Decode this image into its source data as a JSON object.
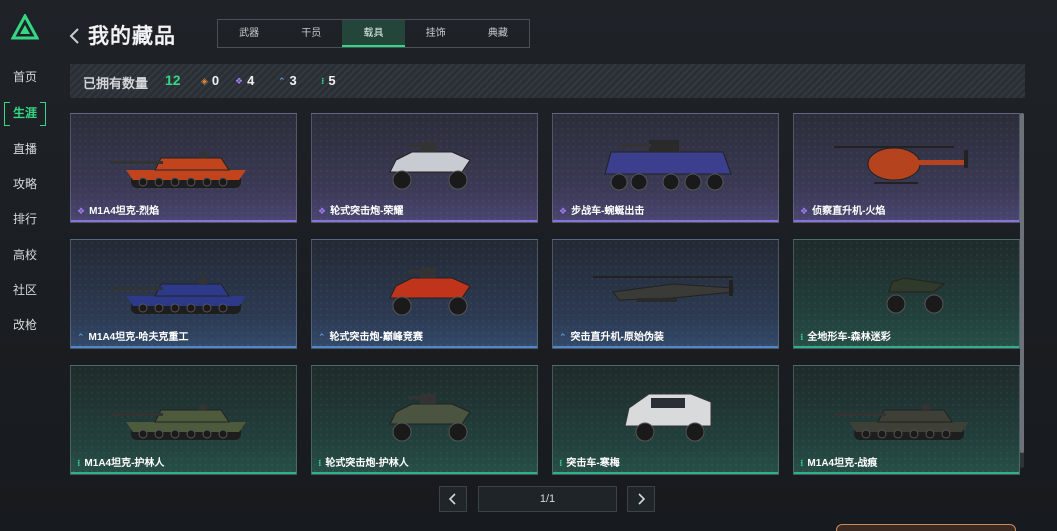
{
  "sidebar": {
    "items": [
      {
        "label": "首页"
      },
      {
        "label": "生涯",
        "active": true
      },
      {
        "label": "直播"
      },
      {
        "label": "攻略"
      },
      {
        "label": "排行"
      },
      {
        "label": "高校"
      },
      {
        "label": "社区"
      },
      {
        "label": "改枪"
      }
    ]
  },
  "header": {
    "title": "我的藏品",
    "tabs": [
      {
        "label": "武器"
      },
      {
        "label": "干员"
      },
      {
        "label": "载具",
        "active": true
      },
      {
        "label": "挂饰"
      },
      {
        "label": "典藏"
      }
    ]
  },
  "counts": {
    "label": "已拥有数量",
    "total": "12",
    "rarities": [
      {
        "icon": "orange-diamond-icon",
        "color": "#e08a3a",
        "count": "0"
      },
      {
        "icon": "purple-diamond-icon",
        "color": "#a07cf0",
        "count": "4"
      },
      {
        "icon": "blue-chevron-icon",
        "color": "#5aa0e8",
        "count": "3"
      },
      {
        "icon": "green-dots-icon",
        "color": "#33d08a",
        "count": "5"
      }
    ]
  },
  "vehicles": [
    {
      "name": "M1A4坦克-烈焰",
      "rarity": "purple",
      "kind": "tank",
      "paint": "#c2441c"
    },
    {
      "name": "轮式突击炮-荣耀",
      "rarity": "purple",
      "kind": "buggy",
      "paint": "#c8ccd2"
    },
    {
      "name": "步战车-蜿蜒出击",
      "rarity": "purple",
      "kind": "apc",
      "paint": "#3b3f8e"
    },
    {
      "name": "侦察直升机-火焰",
      "rarity": "purple",
      "kind": "heli-small",
      "paint": "#b5441e"
    },
    {
      "name": "M1A4坦克-哈夫克重工",
      "rarity": "blue",
      "kind": "tank",
      "paint": "#2d3a8a"
    },
    {
      "name": "轮式突击炮-巅峰竞赛",
      "rarity": "blue",
      "kind": "buggy",
      "paint": "#c0341c"
    },
    {
      "name": "突击直升机-原始伪装",
      "rarity": "blue",
      "kind": "heli-attack",
      "paint": "#3a3b36"
    },
    {
      "name": "全地形车-森林迷彩",
      "rarity": "green",
      "kind": "atv",
      "paint": "#2f3a2a"
    },
    {
      "name": "M1A4坦克-护林人",
      "rarity": "green",
      "kind": "tank",
      "paint": "#4e5a3c"
    },
    {
      "name": "轮式突击炮-护林人",
      "rarity": "green",
      "kind": "buggy",
      "paint": "#4a5440"
    },
    {
      "name": "突击车-寒梅",
      "rarity": "green",
      "kind": "truck",
      "paint": "#d8dadc"
    },
    {
      "name": "M1A4坦克-战痕",
      "rarity": "green",
      "kind": "tank",
      "paint": "#3e4038"
    }
  ],
  "pager": {
    "text": "1/1"
  },
  "colors": {
    "accent": "#35d684"
  }
}
